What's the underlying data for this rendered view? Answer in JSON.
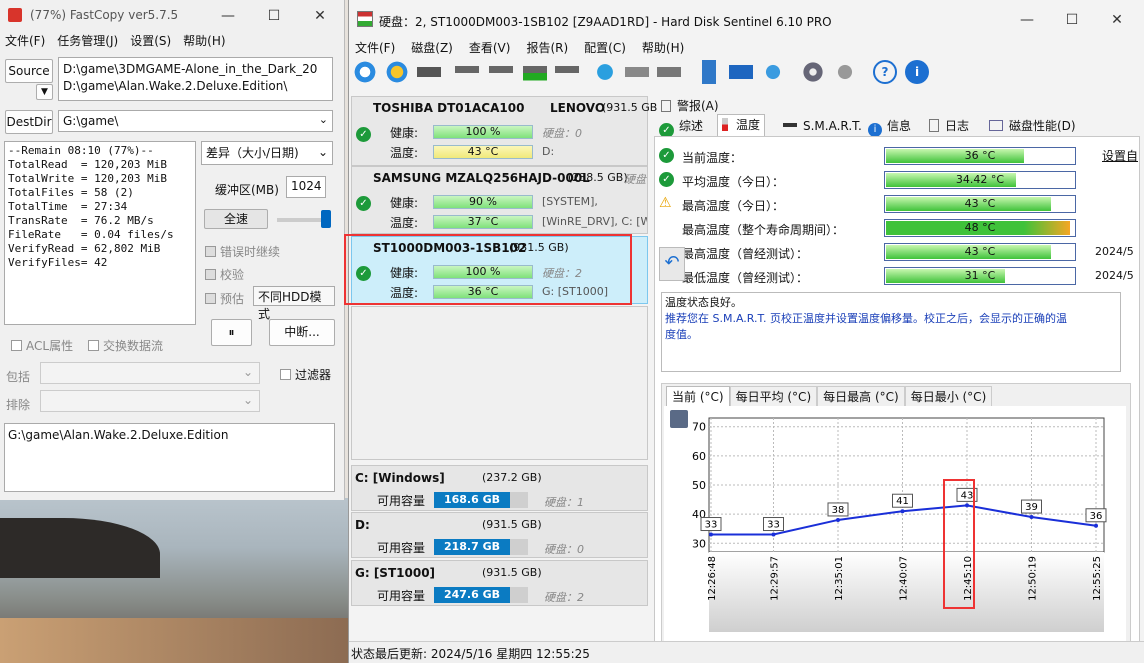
{
  "fastcopy": {
    "title": "(77%) FastCopy ver5.7.5",
    "menu": [
      "文件(F)",
      "任务管理(J)",
      "设置(S)",
      "帮助(H)"
    ],
    "source_label": "Source",
    "source_paths": [
      "D:\\game\\3DMGAME-Alone_in_the_Dark_20",
      "D:\\game\\Alan.Wake.2.Deluxe.Edition\\"
    ],
    "destdir_label": "DestDir",
    "destdir_value": "G:\\game\\",
    "stats": "--Remain 08:10 (77%)--\nTotalRead  = 120,203 MiB\nTotalWrite = 120,203 MiB\nTotalFiles = 58 (2)\nTotalTime  = 27:34\nTransRate  = 76.2 MB/s\nFileRate   = 0.04 files/s\nVerifyRead = 62,802 MiB\nVerifyFiles= 42",
    "mode": "差异（大小/日期)",
    "buffer_label": "缓冲区(MB)",
    "buffer_value": "1024",
    "fullspeed": "全速",
    "opt_error": "错误时继续",
    "opt_verify": "校验",
    "opt_estimate": "预估",
    "hdd_mode": "不同HDD模式",
    "pause": "⏸",
    "stop": "中断...",
    "acl": "ACL属性",
    "altstream": "交换数据流",
    "filter": "过滤器",
    "include": "包括",
    "exclude": "排除",
    "status_path": "G:\\game\\Alan.Wake.2.Deluxe.Edition"
  },
  "hds": {
    "title": "硬盘：2, ST1000DM003-1SB102 [Z9AAD1RD]  -  Hard Disk Sentinel 6.10 PRO",
    "menu": [
      "文件(F)",
      "磁盘(Z)",
      "查看(V)",
      "报告(R)",
      "配置(C)",
      "帮助(H)"
    ],
    "disks": [
      {
        "name": "TOSHIBA DT01ACA100",
        "vendor": "LENOVO",
        "size": "(931.5 GB",
        "health_label": "健康:",
        "health": "100 %",
        "disk_label": "硬盘：0",
        "temp_label": "温度:",
        "temp": "43 °C",
        "part": "D:"
      },
      {
        "name": "SAMSUNG MZALQ256HAJD-000L",
        "size": "(238.5 GB)",
        "extra": "硬盘",
        "health_label": "健康:",
        "health": "90 %",
        "part1": "[SYSTEM],",
        "temp_label": "温度:",
        "temp": "37 °C",
        "part2": "[WinRE_DRV], C: [W"
      },
      {
        "name": "ST1000DM003-1SB102",
        "size": "(931.5 GB)",
        "health_label": "健康:",
        "health": "100 %",
        "disk_label": "硬盘：2",
        "temp_label": "温度:",
        "temp": "36 °C",
        "part": "G: [ST1000]"
      }
    ],
    "volumes": [
      {
        "name": "C: [Windows]",
        "size": "(237.2 GB)",
        "free_label": "可用容量",
        "free": "168.6 GB",
        "disk": "硬盘：1"
      },
      {
        "name": "D:",
        "size": "(931.5 GB)",
        "free_label": "可用容量",
        "free": "218.7 GB",
        "disk": "硬盘：0"
      },
      {
        "name": "G: [ST1000]",
        "size": "(931.5 GB)",
        "free_label": "可用容量",
        "free": "247.6 GB",
        "disk": "硬盘：2"
      }
    ],
    "alert_tab": "警报(A)",
    "tabs": [
      "综述",
      "温度",
      "S.M.A.R.T.",
      "信息",
      "日志",
      "磁盘性能(D)"
    ],
    "temps": [
      {
        "label": "当前温度：",
        "value": "36 °C",
        "pct": 0.36,
        "status": "ok"
      },
      {
        "label": "平均温度（今日）：",
        "value": "34.42 °C",
        "pct": 0.34,
        "status": "ok"
      },
      {
        "label": "最高温度（今日）：",
        "value": "43 °C",
        "pct": 0.43,
        "status": "warn"
      },
      {
        "label": "最高温度（整个寿命周期间）：",
        "value": "48 °C",
        "pct": 0.48,
        "status": "none"
      },
      {
        "label": "最高温度（曾经测试）：",
        "value": "43 °C",
        "pct": 0.43,
        "status": "none",
        "date": "2024/5"
      },
      {
        "label": "最低温度（曾经测试）：",
        "value": "31 °C",
        "pct": 0.31,
        "status": "none",
        "date": "2024/5"
      }
    ],
    "settings_link": "设置自",
    "status_line1": "温度状态良好。",
    "status_line2": "推荐您在 S.M.A.R.T. 页校正温度并设置温度偏移量。校正之后，会显示的正确的温",
    "status_line3": "度值。",
    "chart_tabs": [
      "当前 (°C)",
      "每日平均 (°C)",
      "每日最高 (°C)",
      "每日最小 (°C)"
    ],
    "statusbar": "状态最后更新:    2024/5/16 星期四 12:55:25"
  },
  "chart_data": {
    "type": "line",
    "x": [
      "12:26:48",
      "12:29:57",
      "12:35:01",
      "12:40:07",
      "12:45:10",
      "12:50:19",
      "12:55:25"
    ],
    "values": [
      33,
      33,
      38,
      41,
      43,
      39,
      36
    ],
    "yticks": [
      30,
      40,
      50,
      60,
      70
    ],
    "ylim": [
      27,
      73
    ],
    "xlabel": "",
    "ylabel": "",
    "grid": true,
    "colors": {
      "line": "#1a2fd8"
    }
  }
}
